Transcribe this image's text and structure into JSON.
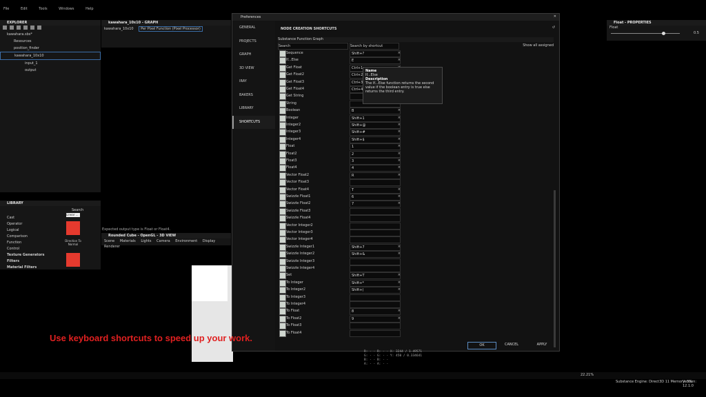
{
  "menu": [
    "File",
    "Edit",
    "Tools",
    "Windows",
    "Help"
  ],
  "explorer": {
    "title": "EXPLORER",
    "project": "kawahara.sbs*",
    "resources": "Resources",
    "item_position_finder": "position_finder",
    "graph_item": "kawahara_10x10",
    "inputs": [
      "input_1",
      "output"
    ]
  },
  "graph": {
    "title": "kawahara_10x10 - GRAPH",
    "tabs": [
      "kawahara_10x10",
      "Per Pixel Function (Pixel Processor)"
    ]
  },
  "properties": {
    "title": "Float - PROPERTIES",
    "label": "Float",
    "value": "0.5"
  },
  "library": {
    "title": "LIBRARY",
    "search_label": "Search",
    "items": [
      "Cast",
      "Operator",
      "Logical",
      "Comparison",
      "Function",
      "Control"
    ],
    "sections": [
      "Texture Generators",
      "Filters",
      "Material Filters"
    ],
    "thumb_label": "Direction To Normal",
    "thumb_top_label": "Linear ..."
  },
  "viewport": {
    "expected_text": "Expected output type is Float or Float4.",
    "title": "Rounded Cube - OpenGL - 3D VIEW",
    "menu": [
      "Scene",
      "Materials",
      "Lights",
      "Camera",
      "Environment",
      "Display",
      "Renderer"
    ]
  },
  "dialog": {
    "title": "Preferences",
    "nav": [
      "GENERAL",
      "PROJECTS",
      "GRAPH",
      "3D VIEW",
      "IRAY",
      "BAKERS",
      "LIBRARY",
      "SHORTCUTS"
    ],
    "section_title": "NODE CREATION SHORTCUTS",
    "graph_type": "Substance Function Graph",
    "search_label": "Search",
    "search_by_shortcut": "Search by shortcut",
    "show_all_assigned": "Show all assigned",
    "rows": [
      {
        "name": "Sequence",
        "key": "Shift+?"
      },
      {
        "name": "If...Else",
        "key": "E"
      },
      {
        "name": "Get Float",
        "key": "Ctrl+1"
      },
      {
        "name": "Get Float2",
        "key": "Ctrl+2"
      },
      {
        "name": "Get Float3",
        "key": "Ctrl+3"
      },
      {
        "name": "Get Float4",
        "key": "Ctrl+4"
      },
      {
        "name": "Get String",
        "key": ""
      },
      {
        "name": "String",
        "key": ""
      },
      {
        "name": "Boolean",
        "key": "B"
      },
      {
        "name": "Integer",
        "key": "Shift+1"
      },
      {
        "name": "Integer2",
        "key": "Shift+@"
      },
      {
        "name": "Integer3",
        "key": "Shift+#"
      },
      {
        "name": "Integer4",
        "key": "Shift+$"
      },
      {
        "name": "Float",
        "key": "1"
      },
      {
        "name": "Float2",
        "key": "2"
      },
      {
        "name": "Float3",
        "key": "3"
      },
      {
        "name": "Float4",
        "key": "4"
      },
      {
        "name": "Vector Float2",
        "key": "R"
      },
      {
        "name": "Vector Float3",
        "key": ""
      },
      {
        "name": "Vector Float4",
        "key": "T"
      },
      {
        "name": "Swizzle Float1",
        "key": "6"
      },
      {
        "name": "Swizzle Float2",
        "key": "7"
      },
      {
        "name": "Swizzle Float3",
        "key": ""
      },
      {
        "name": "Swizzle Float4",
        "key": ""
      },
      {
        "name": "Vector Integer2",
        "key": ""
      },
      {
        "name": "Vector Integer3",
        "key": ""
      },
      {
        "name": "Vector Integer4",
        "key": ""
      },
      {
        "name": "Swizzle Integer1",
        "key": "Shift+7"
      },
      {
        "name": "Swizzle Integer2",
        "key": "Shift+&"
      },
      {
        "name": "Swizzle Integer3",
        "key": ""
      },
      {
        "name": "Swizzle Integer4",
        "key": ""
      },
      {
        "name": "Set",
        "key": "Shift+T"
      },
      {
        "name": "To Integer",
        "key": "Shift+*"
      },
      {
        "name": "To Integer2",
        "key": "Shift+("
      },
      {
        "name": "To Integer3",
        "key": ""
      },
      {
        "name": "To Integer4",
        "key": ""
      },
      {
        "name": "To Float",
        "key": "8"
      },
      {
        "name": "To Float2",
        "key": "9"
      },
      {
        "name": "To Float3",
        "key": ""
      },
      {
        "name": "To Float4",
        "key": ""
      }
    ],
    "tooltip": {
      "name_label": "Name",
      "name_value": "If...Else",
      "desc_label": "Description",
      "desc_value": "The If...Else function returns the second value if the boolean entry is true else returns the third entry."
    },
    "ok": "OK",
    "cancel": "CANCEL",
    "apply": "APPLY"
  },
  "caption": "Use keyboard shortcuts to speed up your work.",
  "status": {
    "zoom": "22.21%",
    "engine": "Substance Engine: Direct3D 11  Memory: 3%",
    "version": "Version: 12.1.0"
  },
  "readout": {
    "lines": [
      "R: - -      R: - -   X: 3244 / 1.49571",
      "G: - -      G: - -   Y: 450 / 0.334641",
      "B: - -      B: - -",
      "A: - -      A: - -"
    ]
  }
}
